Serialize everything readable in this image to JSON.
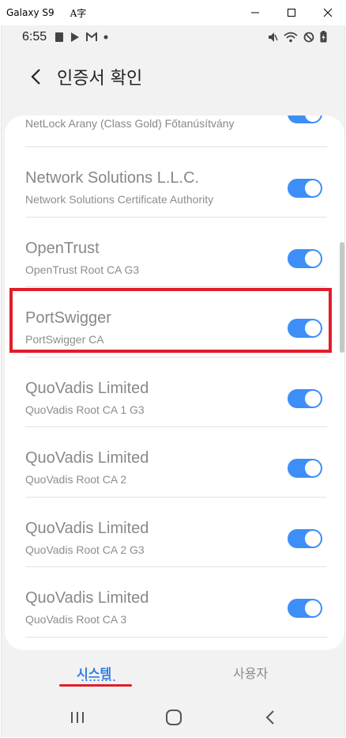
{
  "window": {
    "title": "Galaxy S9",
    "font_icon_glyph": "A字",
    "minimize_label": "Minimize",
    "maximize_label": "Maximize",
    "close_label": "Close"
  },
  "status_bar": {
    "time": "6:55",
    "left_icons": [
      "photo-icon",
      "play-store-icon",
      "gmail-icon",
      "dot-icon"
    ],
    "right_icons": [
      "mute-icon",
      "wifi-icon",
      "do-not-disturb-icon",
      "battery-charging-icon"
    ]
  },
  "header": {
    "title": "인증서 확인"
  },
  "certificates": [
    {
      "name": "NetLock Arany (Class Gold) Főtanúsítvány",
      "sub": "",
      "enabled": true
    },
    {
      "name": "Network Solutions L.L.C.",
      "sub": "Network Solutions Certificate Authority",
      "enabled": true
    },
    {
      "name": "OpenTrust",
      "sub": "OpenTrust Root CA G3",
      "enabled": true
    },
    {
      "name": "PortSwigger",
      "sub": "PortSwigger CA",
      "enabled": true
    },
    {
      "name": "QuoVadis Limited",
      "sub": "QuoVadis Root CA 1 G3",
      "enabled": true
    },
    {
      "name": "QuoVadis Limited",
      "sub": "QuoVadis Root CA 2",
      "enabled": true
    },
    {
      "name": "QuoVadis Limited",
      "sub": "QuoVadis Root CA 2 G3",
      "enabled": true
    },
    {
      "name": "QuoVadis Limited",
      "sub": "QuoVadis Root CA 3",
      "enabled": true
    }
  ],
  "tabs": {
    "system": "시스템",
    "user": "사용자",
    "active": "system"
  },
  "nav": {
    "recent": "recent-apps-icon",
    "home": "home-icon",
    "back": "back-icon"
  },
  "colors": {
    "toggle_on": "#3d8ef7",
    "accent": "#2e7fe0",
    "highlight": "#e01d2a"
  }
}
